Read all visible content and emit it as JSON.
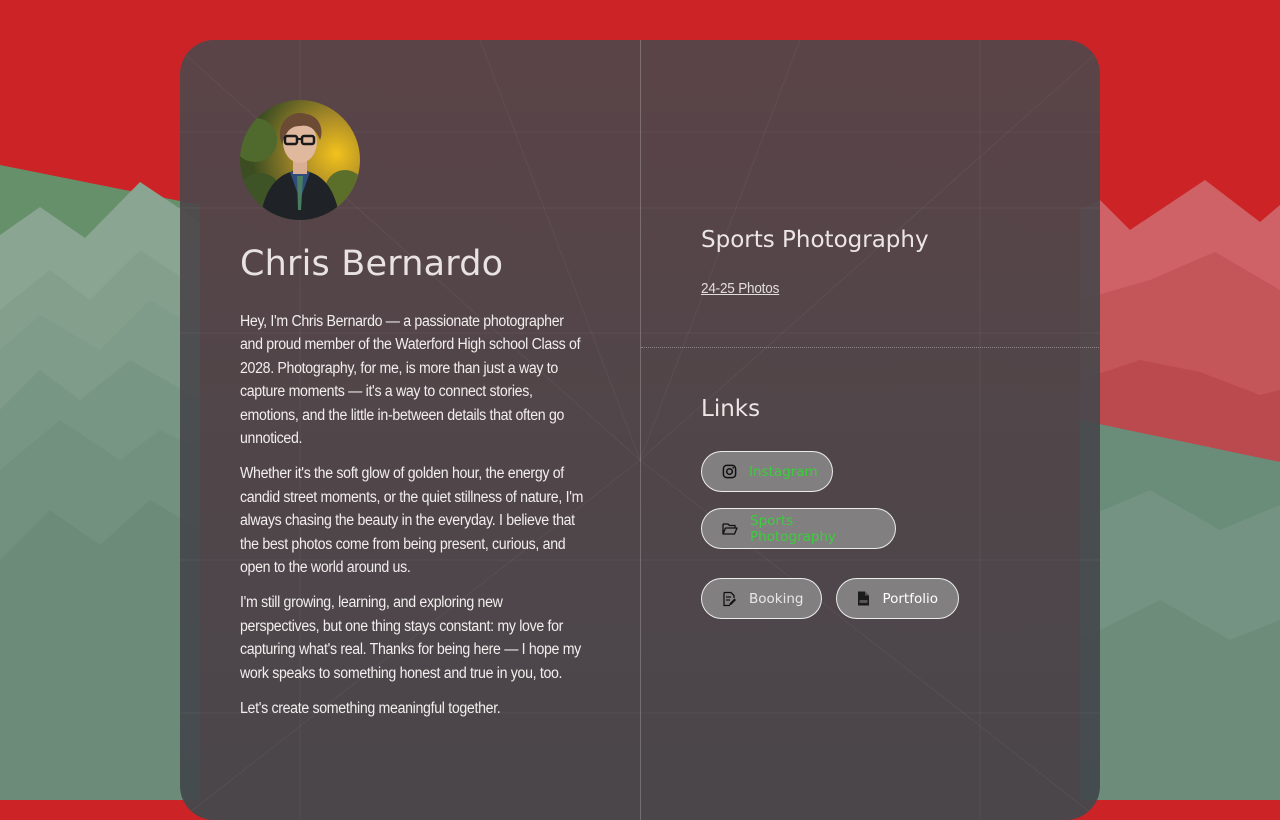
{
  "profile": {
    "name": "Chris Bernardo",
    "avatar_alt": "Portrait of Chris Bernardo"
  },
  "bio": {
    "paragraphs": [
      "Hey, I'm Chris Bernardo — a passionate photographer and proud member of the Waterford High school Class of 2028. Photography, for me, is more than just a way to capture moments — it's a way to connect stories, emotions, and the little in-between details that often go unnoticed.",
      "Whether it's the soft glow of golden hour, the energy of candid street moments, or the quiet stillness of nature, I'm always chasing the beauty in the everyday. I believe that the best photos come from being present, curious, and open to the world around us.",
      "I'm still growing, learning, and exploring new perspectives, but one thing stays constant: my love for capturing what's real. Thanks for being here — I hope my work speaks to something honest and true in you, too.",
      "Let's create something meaningful together."
    ]
  },
  "sports": {
    "title": "Sports Photography",
    "link_label": "24-25 Photos"
  },
  "links": {
    "title": "Links",
    "items": [
      {
        "label": "Instagram",
        "icon": "instagram-icon"
      },
      {
        "label": "Sports Photography",
        "icon": "folder-open-icon"
      },
      {
        "label": "Booking",
        "icon": "edit-document-icon"
      },
      {
        "label": "Portfolio",
        "icon": "pdf-file-icon"
      }
    ]
  },
  "colors": {
    "background_red": "#cc2426",
    "mountain_green": "#6a8d79",
    "link_green": "#3ccd3c"
  }
}
